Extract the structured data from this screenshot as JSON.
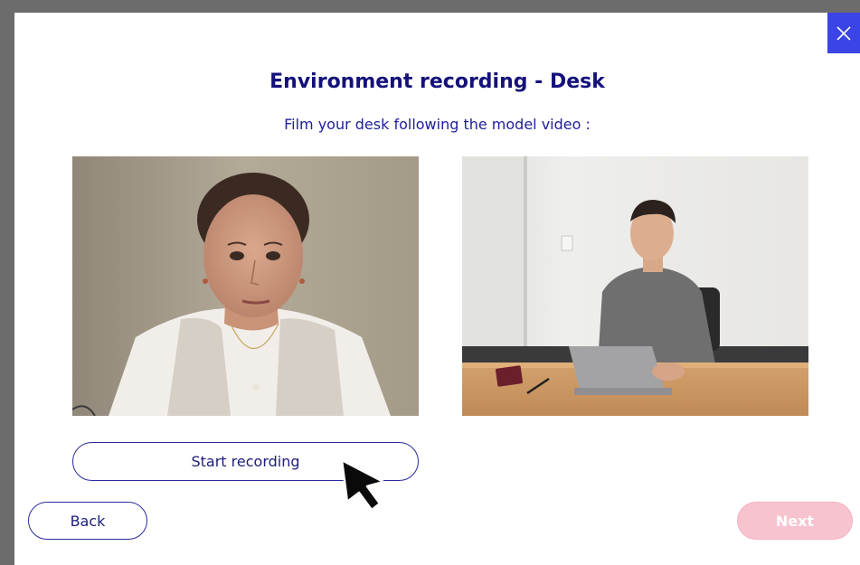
{
  "dialog": {
    "title": "Environment recording - Desk",
    "subtitle": "Film your desk following the model video :",
    "close_icon": "close-icon"
  },
  "webcam": {
    "description": "live-webcam-feed"
  },
  "model_video": {
    "description": "model-video"
  },
  "buttons": {
    "start_recording": "Start recording",
    "back": "Back",
    "next": "Next"
  },
  "colors": {
    "accent": "#3b44e6",
    "title": "#14117a",
    "text": "#1e1e9a",
    "next_disabled": "#f7c3cf"
  }
}
